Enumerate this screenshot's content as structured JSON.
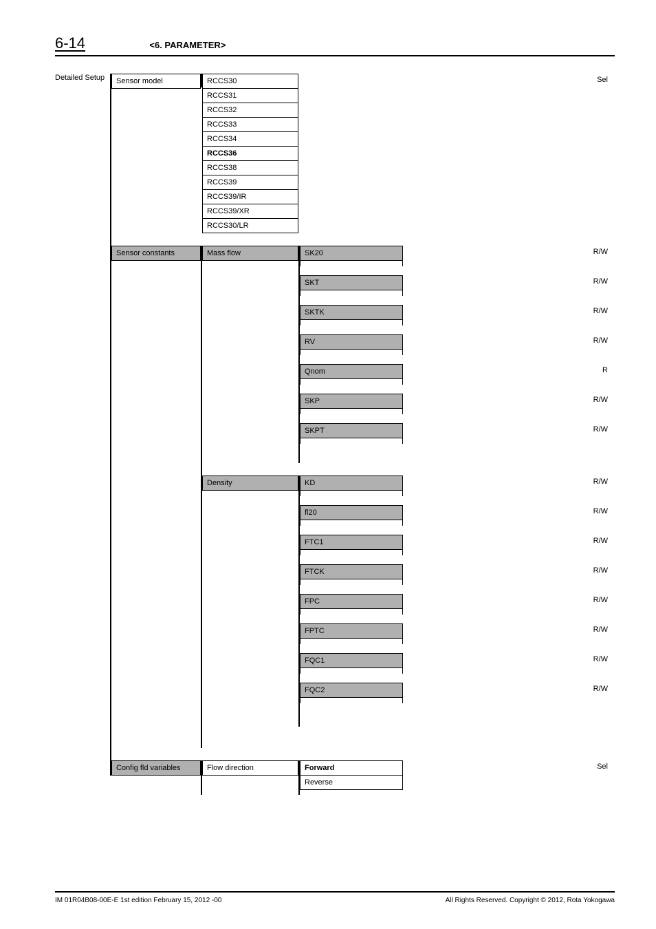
{
  "header": {
    "page_number": "6-14",
    "section": "<6. PARAMETER>"
  },
  "chart_data": {
    "type": "table",
    "tree": {
      "root": "Detailed Setup",
      "children": [
        {
          "label": "Sensor model",
          "access": "Sel",
          "options": [
            "RCCS30",
            "RCCS31",
            "RCCS32",
            "RCCS33",
            "RCCS34",
            "RCCS36",
            "RCCS38",
            "RCCS39",
            "RCCS39/IR",
            "RCCS39/XR",
            "RCCS30/LR"
          ],
          "bold_option": "RCCS36"
        },
        {
          "label": "Sensor constants",
          "children": [
            {
              "label": "Mass flow",
              "params": [
                {
                  "name": "SK20",
                  "access": "R/W"
                },
                {
                  "name": "SKT",
                  "access": "R/W"
                },
                {
                  "name": "SKTK",
                  "access": "R/W"
                },
                {
                  "name": "RV",
                  "access": "R/W"
                },
                {
                  "name": "Qnom",
                  "access": "R"
                },
                {
                  "name": "SKP",
                  "access": "R/W"
                },
                {
                  "name": "SKPT",
                  "access": "R/W"
                }
              ]
            },
            {
              "label": "Density",
              "params": [
                {
                  "name": "KD",
                  "access": "R/W"
                },
                {
                  "name": "fl20",
                  "access": "R/W"
                },
                {
                  "name": "FTC1",
                  "access": "R/W"
                },
                {
                  "name": "FTCK",
                  "access": "R/W"
                },
                {
                  "name": "FPC",
                  "access": "R/W"
                },
                {
                  "name": "FPTC",
                  "access": "R/W"
                },
                {
                  "name": "FQC1",
                  "access": "R/W"
                },
                {
                  "name": "FQC2",
                  "access": "R/W"
                }
              ]
            }
          ]
        },
        {
          "label": "Config fld variables",
          "children": [
            {
              "label": "Flow direction",
              "access": "Sel",
              "options": [
                "Forward",
                "Reverse"
              ],
              "bold_option": "Forward"
            }
          ]
        }
      ]
    }
  },
  "footer": {
    "left": "IM 01R04B08-00E-E    1st edition February 15, 2012 -00",
    "right": "All Rights Reserved. Copyright © 2012, Rota Yokogawa"
  }
}
